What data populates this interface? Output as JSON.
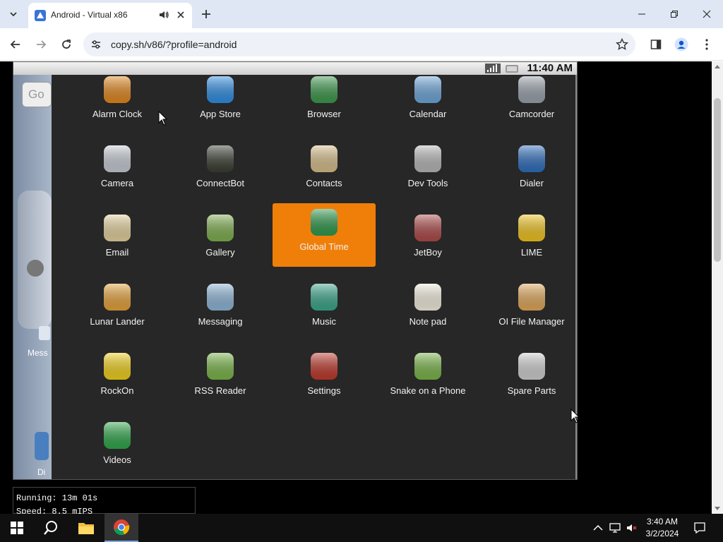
{
  "browser": {
    "tab_title": "Android - Virtual x86",
    "url": "copy.sh/v86/?profile=android",
    "icons": {
      "tab_menu": "chevron-down-icon",
      "audio": "speaker-icon",
      "close": "close-icon",
      "new_tab": "plus-icon",
      "back": "back-arrow-icon",
      "forward": "forward-arrow-icon",
      "reload": "reload-icon",
      "site_info": "tune-icon",
      "bookmark": "star-icon",
      "sidepanel": "side-panel-icon",
      "profile": "profile-icon",
      "menu": "kebab-menu-icon"
    }
  },
  "android": {
    "status": {
      "time": "11:40 AM"
    },
    "home": {
      "search_stub": "Go",
      "partial_labels": [
        "Mess",
        "Di"
      ]
    },
    "apps": [
      {
        "label": "Alarm Clock",
        "icon": "alarm-clock-icon",
        "color": "#e48a1e"
      },
      {
        "label": "App Store",
        "icon": "app-store-icon",
        "color": "#2f8fe6"
      },
      {
        "label": "Browser",
        "icon": "globe-icon",
        "color": "#3d9a4d"
      },
      {
        "label": "Calendar",
        "icon": "calendar-icon",
        "color": "#6fa8dc"
      },
      {
        "label": "Camcorder",
        "icon": "camcorder-icon",
        "color": "#9aa3ad"
      },
      {
        "label": "Camera",
        "icon": "camera-icon",
        "color": "#c9ced6"
      },
      {
        "label": "ConnectBot",
        "icon": "terminal-icon",
        "color": "#3a3f33"
      },
      {
        "label": "Contacts",
        "icon": "contacts-icon",
        "color": "#d9c08c"
      },
      {
        "label": "Dev Tools",
        "icon": "gear-icon",
        "color": "#b9b9b9"
      },
      {
        "label": "Dialer",
        "icon": "dialer-icon",
        "color": "#2f6fbf"
      },
      {
        "label": "Email",
        "icon": "email-icon",
        "color": "#e7d39e"
      },
      {
        "label": "Gallery",
        "icon": "gallery-icon",
        "color": "#7fb04f"
      },
      {
        "label": "Global Time",
        "icon": "globe-clock-icon",
        "color": "#2f9a4d",
        "selected": true
      },
      {
        "label": "JetBoy",
        "icon": "rocket-icon",
        "color": "#b04a4a"
      },
      {
        "label": "LIME",
        "icon": "lemon-icon",
        "color": "#f2c51e"
      },
      {
        "label": "Lunar Lander",
        "icon": "lander-icon",
        "color": "#e8a33a"
      },
      {
        "label": "Messaging",
        "icon": "messaging-icon",
        "color": "#8fb7d9"
      },
      {
        "label": "Music",
        "icon": "music-icon",
        "color": "#3aa88c"
      },
      {
        "label": "Note pad",
        "icon": "notepad-icon",
        "color": "#f5f0e0"
      },
      {
        "label": "OI File Manager",
        "icon": "folder-icon",
        "color": "#e2a95a"
      },
      {
        "label": "RockOn",
        "icon": "rockon-icon",
        "color": "#f2d21a"
      },
      {
        "label": "RSS Reader",
        "icon": "rss-icon",
        "color": "#7ab648"
      },
      {
        "label": "Settings",
        "icon": "settings-icon",
        "color": "#c0392b"
      },
      {
        "label": "Snake on a Phone",
        "icon": "snake-icon",
        "color": "#7ab648"
      },
      {
        "label": "Spare Parts",
        "icon": "spare-parts-icon",
        "color": "#d1d1d1"
      },
      {
        "label": "Videos",
        "icon": "videos-icon",
        "color": "#2fa84a"
      }
    ]
  },
  "emulator_stats": {
    "running": "Running: 13m 01s",
    "speed": "Speed: 8.5 mIPS"
  },
  "taskbar": {
    "time": "3:40 AM",
    "date": "3/2/2024"
  }
}
